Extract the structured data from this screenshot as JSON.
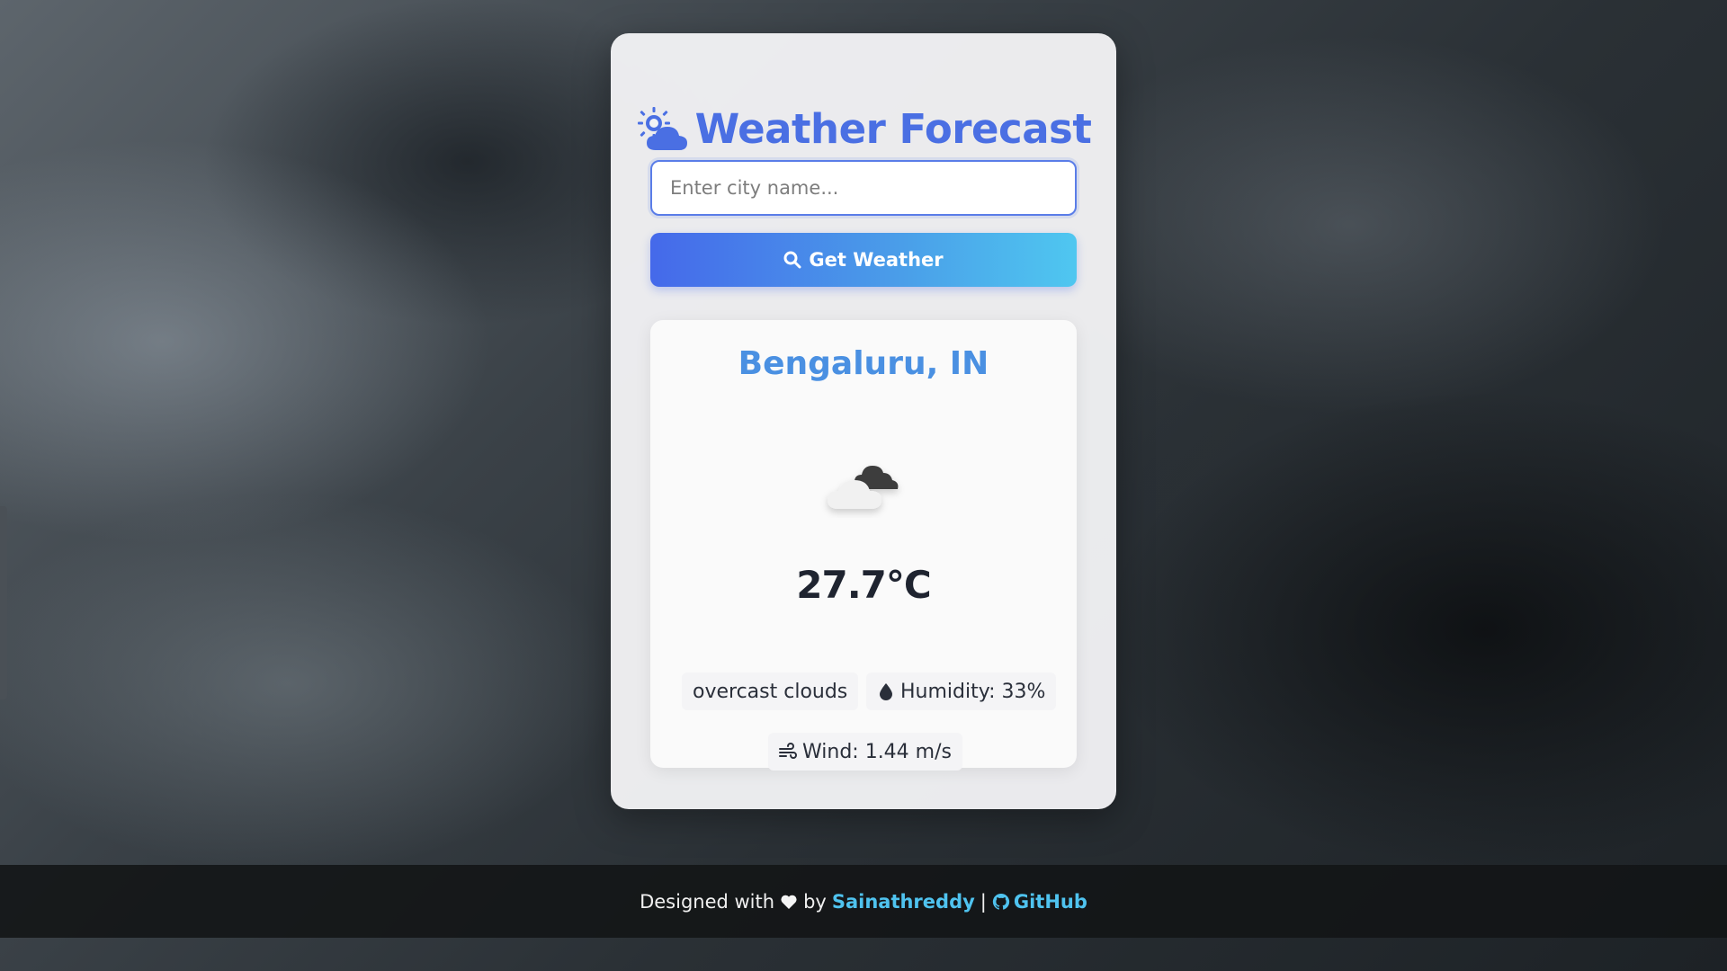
{
  "app": {
    "title": "Weather Forecast",
    "accent_color": "#4a6fe3",
    "title_icon": "sun-behind-cloud-icon"
  },
  "search": {
    "placeholder": "Enter city name...",
    "value": "",
    "button_label": "Get Weather",
    "button_icon": "search-icon"
  },
  "weather": {
    "city": "Bengaluru, IN",
    "icon": "overcast-clouds-icon",
    "temperature": "27.7°C",
    "description": "overcast clouds",
    "humidity": "Humidity: 33%",
    "humidity_icon": "droplet-icon",
    "wind": "Wind: 1.44 m/s",
    "wind_icon": "wind-icon"
  },
  "footer": {
    "prefix": "Designed with",
    "heart_icon": "heart-icon",
    "by": "by",
    "author": "Sainathreddy",
    "separator": "|",
    "github_label": "GitHub",
    "github_icon": "github-icon",
    "link_color": "#4fc3ef"
  }
}
